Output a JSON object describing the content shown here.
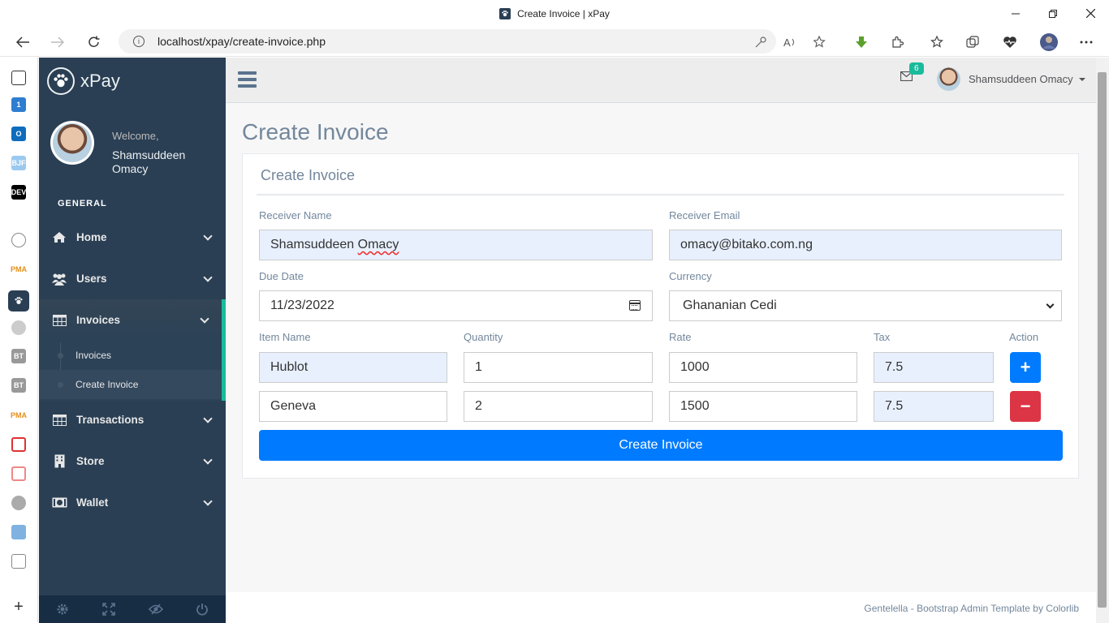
{
  "browser": {
    "window_title": "Create Invoice | xPay",
    "url": "localhost/xpay/create-invoice.php",
    "info_glyph": "i"
  },
  "sidebar": {
    "brand": "xPay",
    "welcome": "Welcome,",
    "user_name": "Shamsuddeen Omacy",
    "section": "GENERAL",
    "items": [
      {
        "label": "Home",
        "icon": "home-icon"
      },
      {
        "label": "Users",
        "icon": "users-icon"
      },
      {
        "label": "Invoices",
        "icon": "table-icon"
      },
      {
        "label": "Transactions",
        "icon": "table-icon"
      },
      {
        "label": "Store",
        "icon": "building-icon"
      },
      {
        "label": "Wallet",
        "icon": "money-icon"
      }
    ],
    "submenu": [
      {
        "label": "Invoices"
      },
      {
        "label": "Create Invoice"
      }
    ]
  },
  "topnav": {
    "mail_count": "6",
    "user_name": "Shamsuddeen Omacy"
  },
  "page": {
    "title": "Create Invoice",
    "panel_title": "Create Invoice"
  },
  "form": {
    "receiver_name_label": "Receiver Name",
    "receiver_name_first": "Shamsuddeen",
    "receiver_name_last": "Omacy",
    "receiver_email_label": "Receiver Email",
    "receiver_email": "omacy@bitako.com.ng",
    "due_date_label": "Due Date",
    "due_date": "11/23/2022",
    "currency_label": "Currency",
    "currency": "Ghananian Cedi",
    "item_name_label": "Item Name",
    "quantity_label": "Quantity",
    "rate_label": "Rate",
    "tax_label": "Tax",
    "action_label": "Action",
    "items": [
      {
        "name": "Hublot",
        "quantity": "1",
        "rate": "1000",
        "tax": "7.5"
      },
      {
        "name": "Geneva",
        "quantity": "2",
        "rate": "1500",
        "tax": "7.5"
      }
    ],
    "add_glyph": "+",
    "remove_glyph": "−",
    "submit_label": "Create Invoice"
  },
  "footer": {
    "text": "Gentelella - Bootstrap Admin Template by Colorlib"
  },
  "colors": {
    "sidebar": "#2a3f54",
    "accent": "#1abb9c",
    "primary": "#007bff",
    "danger": "#dc3545"
  }
}
